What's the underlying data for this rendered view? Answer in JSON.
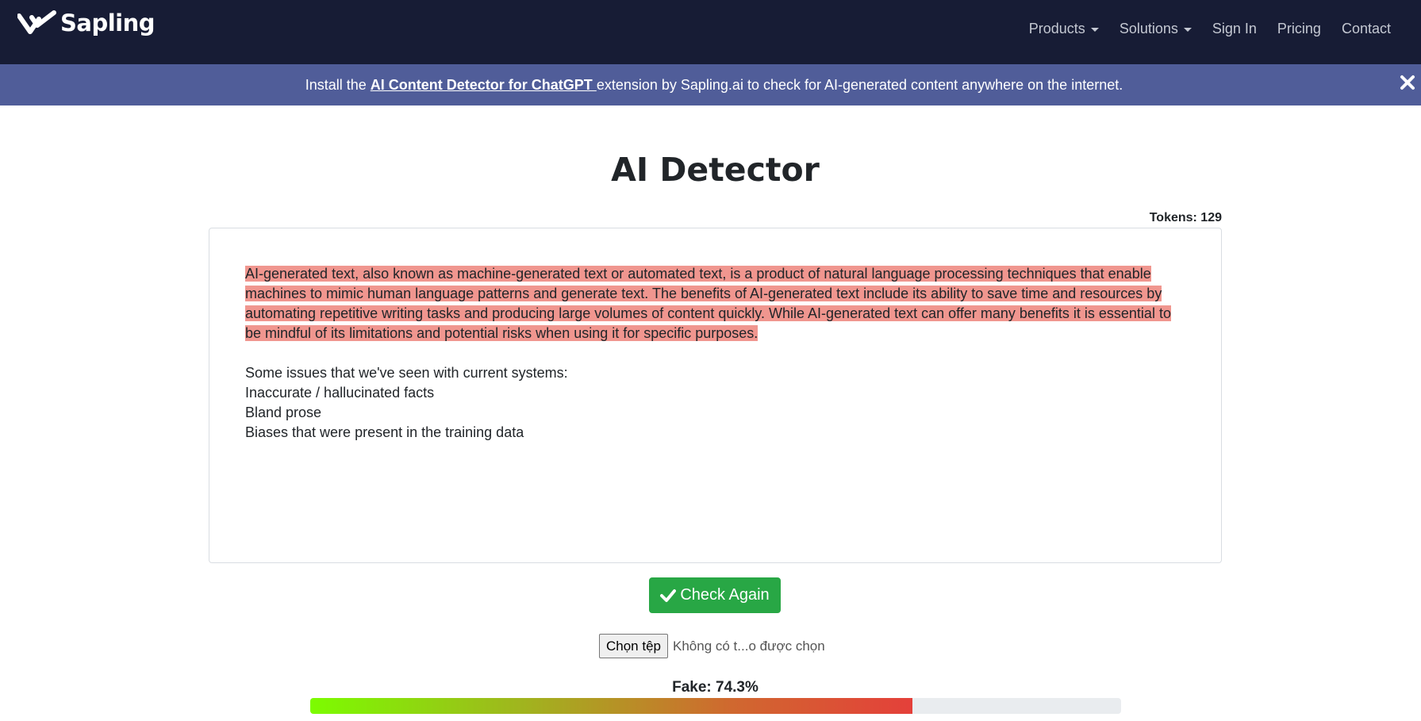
{
  "navbar": {
    "brand": "Sapling",
    "brand_icon": "sapling-logo-icon",
    "items": [
      {
        "label": "Products",
        "dropdown": true
      },
      {
        "label": "Solutions",
        "dropdown": true
      },
      {
        "label": "Sign In",
        "dropdown": false
      },
      {
        "label": "Pricing",
        "dropdown": false
      },
      {
        "label": "Contact",
        "dropdown": false
      }
    ]
  },
  "banner": {
    "prefix": "Install the ",
    "link": "AI Content Detector for ChatGPT ",
    "suffix": " extension by Sapling.ai to check for AI-generated content anywhere on the internet.",
    "close_icon": "close-icon"
  },
  "page": {
    "title": "AI Detector",
    "tokens_label": "Tokens: 129"
  },
  "editor": {
    "highlighted_lines": [
      "AI-generated text, also known as machine-generated text or automated text, is a product of natural language processing techniques that enable",
      "machines to mimic human language patterns and generate text. The benefits of AI-generated text include its ability to save time and resources by",
      "automating repetitive writing tasks and producing large volumes of content quickly. While AI-generated text can offer many benefits it is essential to",
      "be mindful of its limitations and potential risks when using it for specific purposes."
    ],
    "plain_lines": [
      "Some issues that we've seen with current systems:",
      "Inaccurate / hallucinated facts",
      "Bland prose",
      "Biases that were present in the training data"
    ],
    "highlight_color": "#f0968f"
  },
  "actions": {
    "check_label": "Check Again",
    "check_icon": "checkmark-icon",
    "file_button": "Chọn tệp",
    "file_status": "Không có t...o được chọn"
  },
  "result": {
    "fake_label": "Fake: 74.3%",
    "fake_fraction": 0.743
  },
  "colors": {
    "navbar": "#171c35",
    "banner": "#505d99",
    "button": "#28a745"
  }
}
